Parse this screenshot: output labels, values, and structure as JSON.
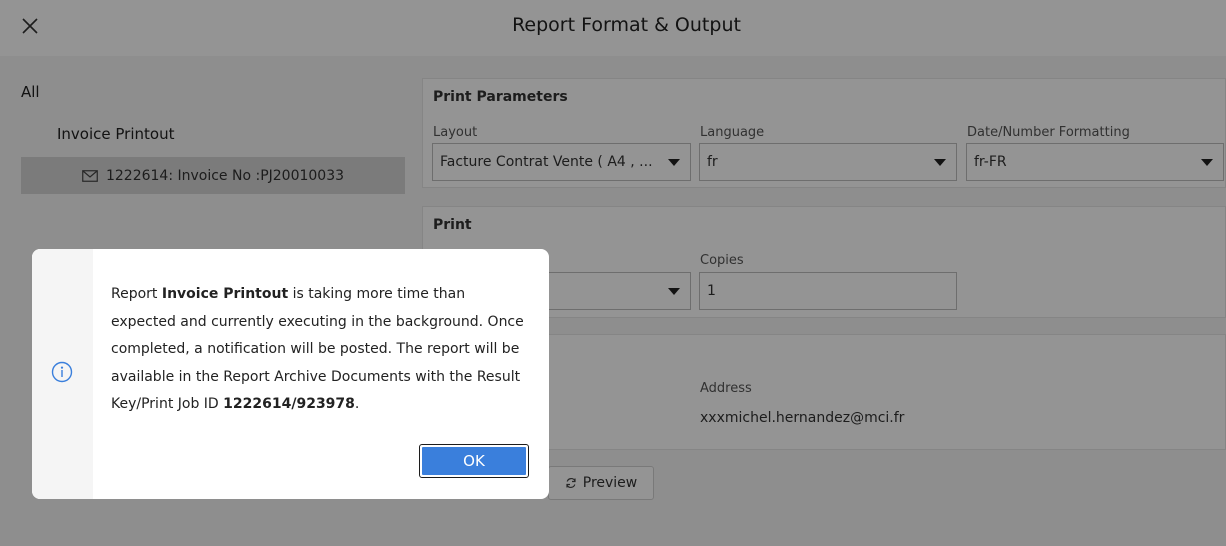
{
  "header": {
    "title": "Report Format & Output",
    "close_icon": "close-icon"
  },
  "sidebar": {
    "all_label": "All",
    "report_label": "Invoice Printout",
    "selected_item": {
      "icon": "envelope-icon",
      "label": "1222614: Invoice No :PJ20010033"
    }
  },
  "print_parameters": {
    "title": "Print Parameters",
    "layout_label": "Layout",
    "layout_value": "Facture Contrat Vente ( A4 , ...",
    "language_label": "Language",
    "language_value": "fr",
    "formatting_label": "Date/Number Formatting",
    "formatting_value": "fr-FR"
  },
  "print": {
    "title": "Print",
    "copies_label": "Copies",
    "copies_value": "1"
  },
  "email": {
    "address_label": "Address",
    "address_value": "xxxmichel.hernandez@mci.fr"
  },
  "preview_button": {
    "icon": "refresh-icon",
    "label": "Preview"
  },
  "dialog": {
    "icon": "info-icon",
    "msg_part1": "Report ",
    "report_name": "Invoice Printout",
    "msg_part2": " is taking more time than expected and currently executing in the background. Once completed, a notification will be posted. The report will be available in the Report Archive Documents with the Result Key/Print Job ID ",
    "job_id": "1222614/923978",
    "msg_part3": ".",
    "ok_label": "OK"
  },
  "colors": {
    "accent": "#c1440e",
    "primary_button": "#3a7fdc",
    "info_icon": "#3a7fdc"
  }
}
